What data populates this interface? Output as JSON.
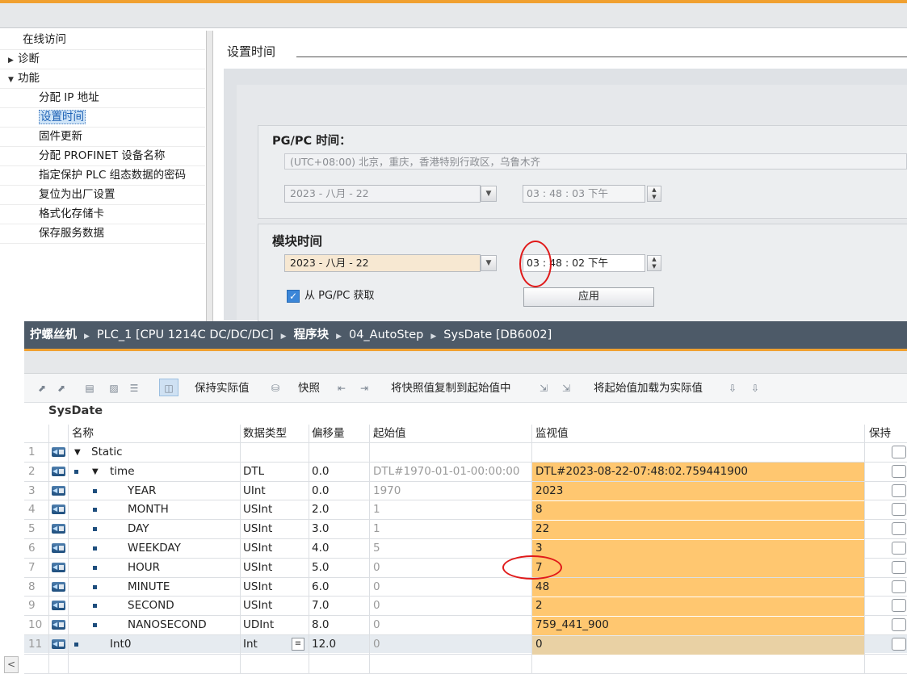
{
  "nav": {
    "items": [
      {
        "label": "在线访问",
        "indent": 0,
        "toggle": ""
      },
      {
        "label": "诊断",
        "indent": 0,
        "toggle": "▶"
      },
      {
        "label": "功能",
        "indent": 0,
        "toggle": "▼"
      },
      {
        "label": "分配 IP 地址",
        "indent": 1,
        "toggle": ""
      },
      {
        "label": "设置时间",
        "indent": 1,
        "toggle": "",
        "selected": true
      },
      {
        "label": "固件更新",
        "indent": 1,
        "toggle": ""
      },
      {
        "label": "分配 PROFINET 设备名称",
        "indent": 1,
        "toggle": ""
      },
      {
        "label": "指定保护 PLC 组态数据的密码",
        "indent": 1,
        "toggle": ""
      },
      {
        "label": "复位为出厂设置",
        "indent": 1,
        "toggle": ""
      },
      {
        "label": "格式化存储卡",
        "indent": 1,
        "toggle": ""
      },
      {
        "label": "保存服务数据",
        "indent": 1,
        "toggle": ""
      }
    ]
  },
  "settings": {
    "title": "设置时间",
    "pgpc_title": "PG/PC 时间：",
    "timezone": "(UTC+08:00) 北京，重庆，香港特别行政区，乌鲁木齐",
    "pgpc_date": "2023 - 八月  - 22",
    "pgpc_time": "03 : 48 : 03   下午",
    "module_title": "模块时间",
    "module_date": "2023 - 八月  - 22",
    "module_time": "03 : 48 : 02   下午",
    "from_pgpc_label": "从 PG/PC 获取",
    "apply_label": "应用"
  },
  "breadcrumb": [
    "拧螺丝机",
    "PLC_1 [CPU 1214C DC/DC/DC]",
    "程序块",
    "04_AutoStep",
    "SysDate [DB6002]"
  ],
  "toolbar": {
    "keep_actual": "保持实际值",
    "snapshot": "快照",
    "copy_snapshot": "将快照值复制到起始值中",
    "load_start": "将起始值加载为实际值"
  },
  "db_name": "SysDate",
  "table": {
    "headers": {
      "name": "名称",
      "type": "数据类型",
      "offset": "偏移量",
      "start": "起始值",
      "monitor": "监视值",
      "retain": "保持"
    },
    "rows": [
      {
        "num": "1",
        "name": "Static",
        "type": "",
        "offset": "",
        "start": "",
        "monitor": ""
      },
      {
        "num": "2",
        "name": "time",
        "type": "DTL",
        "offset": "0.0",
        "start": "DTL#1970-01-01-00:00:00",
        "monitor": "DTL#2023-08-22-07:48:02.759441900"
      },
      {
        "num": "3",
        "name": "YEAR",
        "type": "UInt",
        "offset": "0.0",
        "start": "1970",
        "monitor": "2023"
      },
      {
        "num": "4",
        "name": "MONTH",
        "type": "USInt",
        "offset": "2.0",
        "start": "1",
        "monitor": "8"
      },
      {
        "num": "5",
        "name": "DAY",
        "type": "USInt",
        "offset": "3.0",
        "start": "1",
        "monitor": "22"
      },
      {
        "num": "6",
        "name": "WEEKDAY",
        "type": "USInt",
        "offset": "4.0",
        "start": "5",
        "monitor": "3"
      },
      {
        "num": "7",
        "name": "HOUR",
        "type": "USInt",
        "offset": "5.0",
        "start": "0",
        "monitor": "7"
      },
      {
        "num": "8",
        "name": "MINUTE",
        "type": "USInt",
        "offset": "6.0",
        "start": "0",
        "monitor": "48"
      },
      {
        "num": "9",
        "name": "SECOND",
        "type": "USInt",
        "offset": "7.0",
        "start": "0",
        "monitor": "2"
      },
      {
        "num": "10",
        "name": "NANOSECOND",
        "type": "UDInt",
        "offset": "8.0",
        "start": "0",
        "monitor": "759_441_900"
      },
      {
        "num": "11",
        "name": "Int0",
        "type": "Int",
        "offset": "12.0",
        "start": "0",
        "monitor": "0"
      }
    ]
  },
  "colors": {
    "accent": "#f0a030",
    "monitor_bg": "#ffc770",
    "title_bar": "#4d5a68",
    "annotation": "#e01a1a"
  }
}
